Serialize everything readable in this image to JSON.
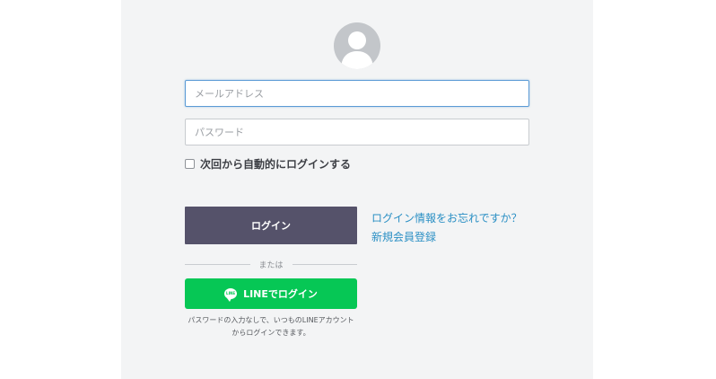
{
  "form": {
    "email_placeholder": "メールアドレス",
    "password_placeholder": "パスワード",
    "remember_label": "次回から自動的にログインする",
    "login_label": "ログイン",
    "forgot_link": "ログイン情報をお忘れですか？",
    "register_link": "新規会員登録",
    "divider_label": "または",
    "line_icon_text": "LINE",
    "line_login_label": "LINEでログイン",
    "line_note": "パスワードの入力なしで、いつものLINEアカウントからログインできます。"
  },
  "icons": {
    "avatar": "user-avatar-icon",
    "line": "line-logo-icon"
  },
  "colors": {
    "panel_bg": "#f3f4f5",
    "login_button": "#55526a",
    "line_button": "#06c755",
    "link": "#2a8fc4",
    "focus_border": "#5b9bd5"
  }
}
